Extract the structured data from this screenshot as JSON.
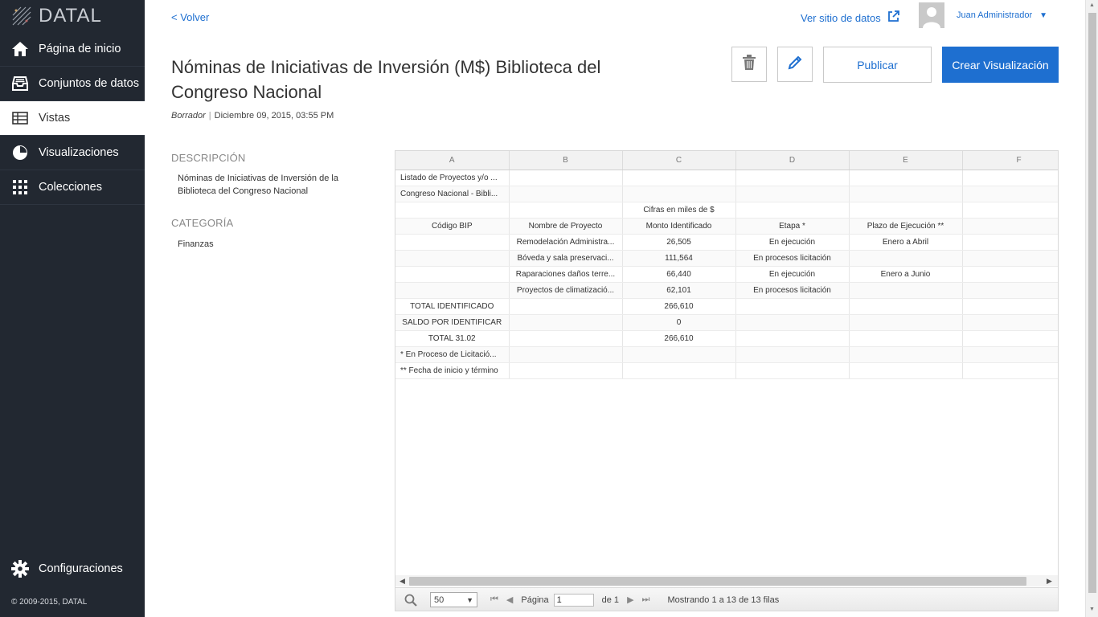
{
  "brand": {
    "name": "DATAL",
    "copyright": "© 2009-2015, DATAL"
  },
  "sidebar": {
    "items": [
      {
        "label": "Página de inicio",
        "icon": "home-icon"
      },
      {
        "label": "Conjuntos de datos",
        "icon": "inbox-icon"
      },
      {
        "label": "Vistas",
        "icon": "table-icon",
        "active": true
      },
      {
        "label": "Visualizaciones",
        "icon": "pie-chart-icon"
      },
      {
        "label": "Colecciones",
        "icon": "grid-icon"
      }
    ],
    "settings": "Configuraciones"
  },
  "header": {
    "back": "< Volver",
    "site_link": "Ver sitio de datos",
    "user": "Juan Administrador"
  },
  "page": {
    "title": "Nóminas de Iniciativas de Inversión (M$) Biblioteca del Congreso Nacional",
    "status": "Borrador",
    "date": "Diciembre 09, 2015, 03:55 PM",
    "publish": "Publicar",
    "create": "Crear Visualización",
    "description_h": "DESCRIPCIÓN",
    "description": "Nóminas de Iniciativas de Inversión de la Biblioteca del Congreso Nacional",
    "category_h": "CATEGORÍA",
    "category": "Finanzas"
  },
  "sheet": {
    "columns": [
      "A",
      "B",
      "C",
      "D",
      "E",
      "F"
    ],
    "rows": [
      [
        "Listado de Proyectos y/o ...",
        "",
        "",
        "",
        "",
        ""
      ],
      [
        "Congreso Nacional - Bibli...",
        "",
        "",
        "",
        "",
        ""
      ],
      [
        "",
        "",
        "Cifras en miles de $",
        "",
        "",
        ""
      ],
      [
        "Código BIP",
        "Nombre de Proyecto",
        "Monto Identificado",
        "Etapa *",
        "Plazo de Ejecución **",
        ""
      ],
      [
        "",
        "Remodelación Administra...",
        "26,505",
        "En ejecución",
        "Enero a Abril",
        ""
      ],
      [
        "",
        "Bóveda y sala preservaci...",
        "111,564",
        "En procesos licitación",
        "",
        ""
      ],
      [
        "",
        "Raparaciones daños terre...",
        "66,440",
        "En ejecución",
        "Enero a Junio",
        ""
      ],
      [
        "",
        "Proyectos de climatizació...",
        "62,101",
        "En procesos licitación",
        "",
        ""
      ],
      [
        "TOTAL IDENTIFICADO",
        "",
        "266,610",
        "",
        "",
        ""
      ],
      [
        "SALDO POR IDENTIFICAR",
        "",
        "0",
        "",
        "",
        ""
      ],
      [
        "TOTAL 31.02",
        "",
        "266,610",
        "",
        "",
        ""
      ],
      [
        "* En Proceso de Licitació...",
        "",
        "",
        "",
        "",
        ""
      ],
      [
        "** Fecha de inicio y término",
        "",
        "",
        "",
        "",
        ""
      ]
    ],
    "left_rows": [
      0,
      1,
      11,
      12
    ]
  },
  "pager": {
    "page_size": "50",
    "page_label": "Página",
    "page_value": "1",
    "of_label": "de 1",
    "info": "Mostrando 1 a 13 de 13 filas"
  },
  "colors": {
    "sidebar_bg": "#222831",
    "accent": "#1e6fd0"
  }
}
